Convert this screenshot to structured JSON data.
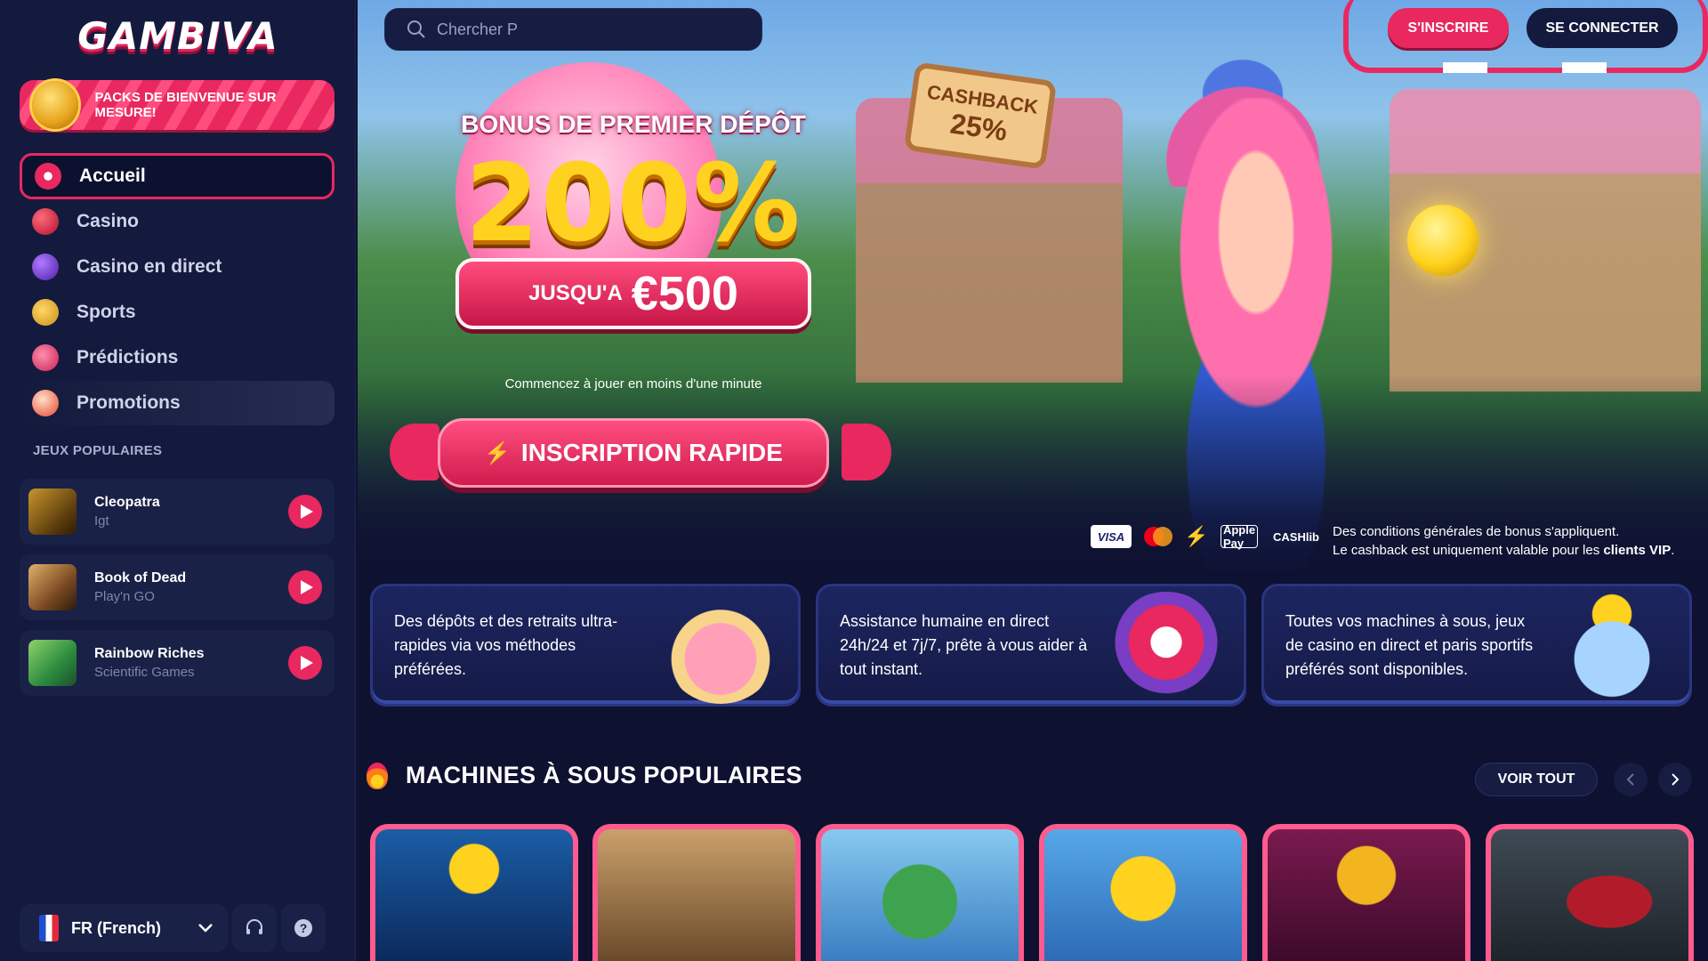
{
  "brand": {
    "logo_text": "GAMBIVA"
  },
  "sidebar": {
    "welcome_banner": "PACKS DE BIENVENUE SUR MESURE!",
    "nav": [
      {
        "label": "Accueil",
        "icon": "home-icon",
        "active": true
      },
      {
        "label": "Casino",
        "icon": "casino-icon"
      },
      {
        "label": "Casino en direct",
        "icon": "live-casino-icon"
      },
      {
        "label": "Sports",
        "icon": "sports-icon"
      },
      {
        "label": "Prédictions",
        "icon": "predictions-icon"
      },
      {
        "label": "Promotions",
        "icon": "promotions-icon"
      }
    ],
    "popular_label": "JEUX POPULAIRES",
    "popular_games": [
      {
        "name": "Cleopatra",
        "provider": "Igt"
      },
      {
        "name": "Book of Dead",
        "provider": "Play'n GO"
      },
      {
        "name": "Rainbow Riches",
        "provider": "Scientific Games"
      }
    ],
    "language": "FR (French)"
  },
  "header": {
    "search_placeholder": "Chercher P",
    "signup": "S'INSCRIRE",
    "login": "SE CONNECTER"
  },
  "hero": {
    "bonus_title": "BONUS DE PREMIER DÉPÔT",
    "bonus_percent": "200%",
    "bonus_upto": "JUSQU'A",
    "bonus_amount": "€500",
    "bonus_sub": "Commencez à jouer en moins d'une minute",
    "cashback_title": "CASHBACK",
    "cashback_value": "25%",
    "cta": "INSCRIPTION RAPIDE",
    "payments": [
      "VISA",
      "Mastercard",
      "Apple Pay",
      "CASHlib"
    ],
    "terms_line1": "Des conditions générales de bonus s'appliquent.",
    "terms_line2_prefix": "Le cashback est uniquement valable pour les ",
    "terms_line2_bold": "clients VIP",
    "terms_line2_suffix": "."
  },
  "features": [
    {
      "text": "Des dépôts et des retraits ultra-rapides via vos méthodes préférées."
    },
    {
      "text": "Assistance humaine en direct 24h/24 et 7j/7, prête à vous aider à tout instant."
    },
    {
      "text": "Toutes vos machines à sous, jeux de casino en direct et paris sportifs préférés sont disponibles."
    }
  ],
  "slots": {
    "title": "MACHINES À SOUS POPULAIRES",
    "view_all": "VOIR TOUT"
  },
  "colors": {
    "accent": "#e8285f",
    "background": "#0e1130",
    "sidebar": "#141a3d"
  }
}
